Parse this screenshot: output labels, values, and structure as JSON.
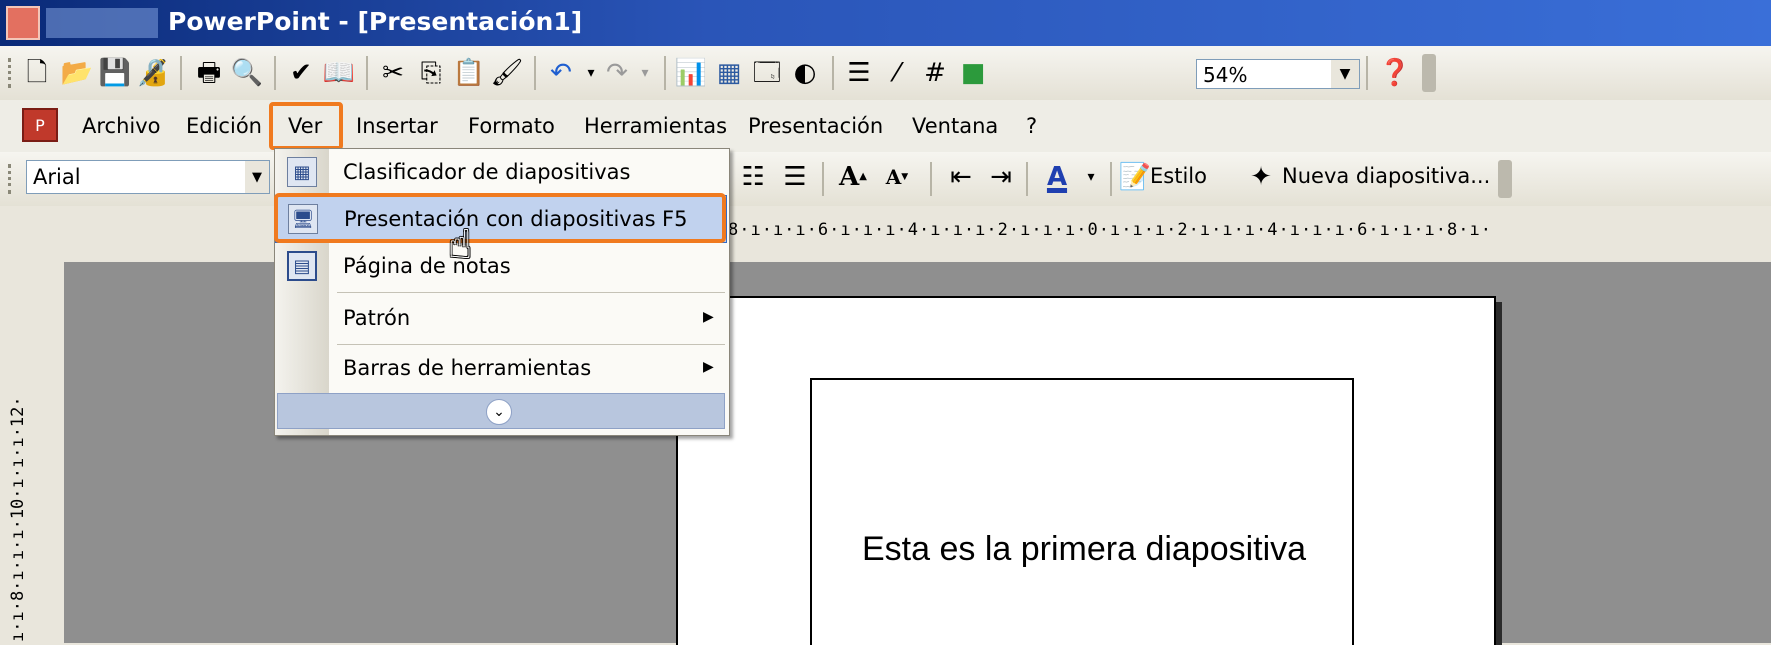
{
  "titlebar": {
    "title": "PowerPoint - [Presentación1]"
  },
  "toolbar_std": {
    "zoom": "54%",
    "icons": [
      "new-icon",
      "open-icon",
      "save-icon",
      "permission-icon",
      "print-icon",
      "print-preview-icon",
      "spelling-icon",
      "research-icon",
      "cut-icon",
      "copy-icon",
      "paste-icon",
      "format-painter-icon",
      "undo-icon",
      "redo-icon",
      "insert-chart-icon",
      "insert-table-icon",
      "tables-borders-icon",
      "color-grayscale-icon",
      "expand-all-icon",
      "show-formatting-icon",
      "show-grid-icon",
      "color-icon",
      "help-icon"
    ]
  },
  "menubar": {
    "items": [
      "Archivo",
      "Edición",
      "Ver",
      "Insertar",
      "Formato",
      "Herramientas",
      "Presentación",
      "Ventana",
      "?"
    ]
  },
  "toolbar_fmt": {
    "font": "Arial",
    "estilo": "Estilo",
    "nueva": "Nueva diapositiva..."
  },
  "ruler": {
    "horizontal": "8·ı·ı·ı·6·ı·ı·ı·4·ı·ı·ı·2·ı·ı·ı·0·ı·ı·ı·2·ı·ı·ı·4·ı·ı·ı·6·ı·ı·ı·8·ı·ı·ı",
    "vertical": "ı·ı·8·ı·ı·ı·10·ı·ı·ı·12·"
  },
  "dropdown": {
    "items": [
      {
        "label": "Clasificador de diapositivas",
        "shortcut": "",
        "submenu": false,
        "icon": "slide-sorter-icon"
      },
      {
        "label": "Presentación con diapositivas",
        "shortcut": "F5",
        "submenu": false,
        "icon": "slide-show-icon",
        "highlighted": true
      },
      {
        "label": "Página de notas",
        "shortcut": "",
        "submenu": false,
        "icon": "notes-page-icon"
      },
      {
        "label": "Patrón",
        "shortcut": "",
        "submenu": true
      },
      {
        "label": "Barras de herramientas",
        "shortcut": "",
        "submenu": true
      }
    ]
  },
  "slide": {
    "text": "Esta es la primera diapositiva"
  },
  "colors": {
    "highlight_border": "#f07a1f",
    "menu_highlight": "#c1d2ee",
    "title_bar": "#2a55b8"
  }
}
